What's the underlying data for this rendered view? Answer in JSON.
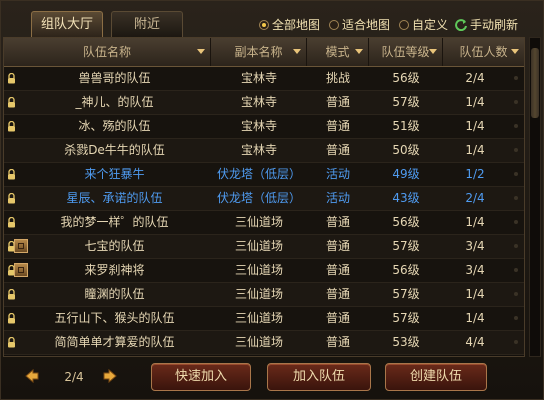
{
  "tabs": {
    "active": "组队大厅",
    "inactive": "附近"
  },
  "filters": [
    {
      "label": "全部地图",
      "selected": true
    },
    {
      "label": "适合地图",
      "selected": false
    },
    {
      "label": "自定义",
      "selected": false
    }
  ],
  "refresh_label": "手动刷新",
  "columns": [
    "队伍名称",
    "副本名称",
    "模式",
    "队伍等级",
    "队伍人数"
  ],
  "rows": [
    {
      "name": "兽兽哥的队伍",
      "dungeon": "宝林寺",
      "mode": "挑战",
      "level": "56级",
      "count": "2/4",
      "lock": true,
      "badge": false,
      "highlight": false
    },
    {
      "name": "_神儿、的队伍",
      "dungeon": "宝林寺",
      "mode": "普通",
      "level": "57级",
      "count": "1/4",
      "lock": true,
      "badge": false,
      "highlight": false
    },
    {
      "name": "冰、殇的队伍",
      "dungeon": "宝林寺",
      "mode": "普通",
      "level": "51级",
      "count": "1/4",
      "lock": true,
      "badge": false,
      "highlight": false
    },
    {
      "name": "杀戮De牛牛的队伍",
      "dungeon": "宝林寺",
      "mode": "普通",
      "level": "50级",
      "count": "1/4",
      "lock": false,
      "badge": false,
      "highlight": false
    },
    {
      "name": "来个狂暴牛",
      "dungeon": "伏龙塔（低层）",
      "mode": "活动",
      "level": "49级",
      "count": "1/2",
      "lock": true,
      "badge": false,
      "highlight": true
    },
    {
      "name": "星辰、承诺的队伍",
      "dungeon": "伏龙塔（低层）",
      "mode": "活动",
      "level": "43级",
      "count": "2/4",
      "lock": true,
      "badge": false,
      "highlight": true
    },
    {
      "name": "我的梦一样゜的队伍",
      "dungeon": "三仙道场",
      "mode": "普通",
      "level": "56级",
      "count": "1/4",
      "lock": true,
      "badge": false,
      "highlight": false
    },
    {
      "name": "七宝的队伍",
      "dungeon": "三仙道场",
      "mode": "普通",
      "level": "57级",
      "count": "3/4",
      "lock": true,
      "badge": true,
      "highlight": false
    },
    {
      "name": "来罗刹神将",
      "dungeon": "三仙道场",
      "mode": "普通",
      "level": "56级",
      "count": "3/4",
      "lock": true,
      "badge": true,
      "highlight": false
    },
    {
      "name": "瞳渊的队伍",
      "dungeon": "三仙道场",
      "mode": "普通",
      "level": "57级",
      "count": "1/4",
      "lock": true,
      "badge": false,
      "highlight": false
    },
    {
      "name": "五行山下、猴头的队伍",
      "dungeon": "三仙道场",
      "mode": "普通",
      "level": "57级",
      "count": "1/4",
      "lock": true,
      "badge": false,
      "highlight": false
    },
    {
      "name": "简简单单才算爱的队伍",
      "dungeon": "三仙道场",
      "mode": "普通",
      "level": "53级",
      "count": "4/4",
      "lock": true,
      "badge": false,
      "highlight": false
    }
  ],
  "pager": {
    "text": "2/4"
  },
  "buttons": {
    "quick_join": "快速加入",
    "join_team": "加入队伍",
    "create_team": "创建队伍"
  },
  "colors": {
    "highlight_text": "#4f9bf0",
    "accent_gold": "#f3c84a",
    "button_red": "#6a2a1a"
  }
}
